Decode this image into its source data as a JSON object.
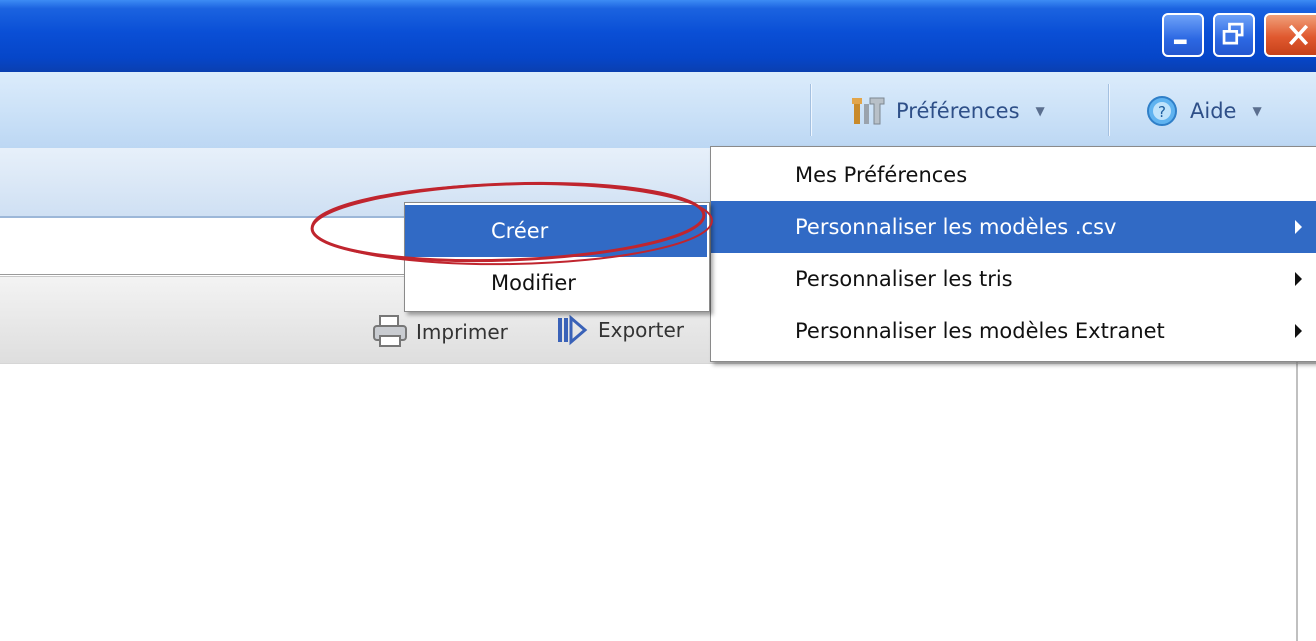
{
  "window_controls": {
    "minimize_icon": "minimize-icon",
    "maximize_icon": "restore-icon",
    "close_icon": "close-icon"
  },
  "header": {
    "preferences_label": "Préférences",
    "preferences_icon": "tools-icon",
    "help_label": "Aide",
    "help_icon": "help-icon"
  },
  "toolbar": {
    "print_label": "Imprimer",
    "print_icon": "printer-icon",
    "export_label": "Exporter",
    "export_icon": "export-icon"
  },
  "preferences_menu": {
    "items": [
      {
        "label": "Mes Préférences",
        "submenu": false,
        "selected": false
      },
      {
        "label": "Personnaliser les modèles .csv",
        "submenu": true,
        "selected": true
      },
      {
        "label": "Personnaliser les tris",
        "submenu": true,
        "selected": false
      },
      {
        "label": "Personnaliser les modèles Extranet",
        "submenu": true,
        "selected": false
      }
    ]
  },
  "csv_submenu": {
    "items": [
      {
        "label": "Créer",
        "selected": true
      },
      {
        "label": "Modifier",
        "selected": false
      }
    ]
  },
  "colors": {
    "selection": "#316ac5",
    "titlebar": "#0a4fd6",
    "annotation": "#c0252e"
  }
}
